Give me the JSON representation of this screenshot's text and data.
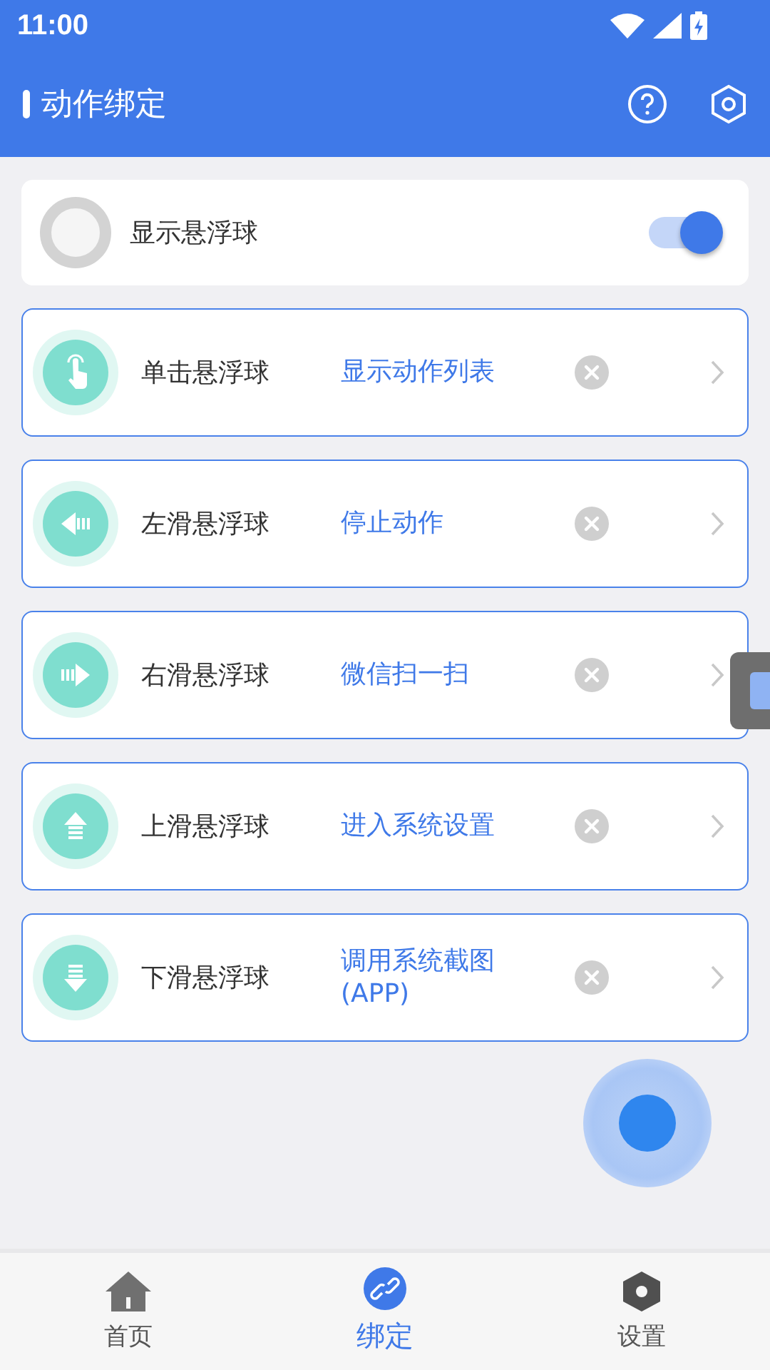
{
  "status_bar": {
    "time": "11:00"
  },
  "app_bar": {
    "title": "动作绑定"
  },
  "toggle_card": {
    "label": "显示悬浮球",
    "on": true
  },
  "bindings": [
    {
      "kind": "tap",
      "label": "单击悬浮球",
      "action": "显示动作列表"
    },
    {
      "kind": "left",
      "label": "左滑悬浮球",
      "action": "停止动作"
    },
    {
      "kind": "right",
      "label": "右滑悬浮球",
      "action": "微信扫一扫"
    },
    {
      "kind": "up",
      "label": "上滑悬浮球",
      "action": "进入系统设置"
    },
    {
      "kind": "down",
      "label": "下滑悬浮球",
      "action": "调用系统截图\n(APP)"
    }
  ],
  "bottom_nav": [
    {
      "kind": "home",
      "label": "首页",
      "selected": false
    },
    {
      "kind": "link",
      "label": "绑定",
      "selected": true
    },
    {
      "kind": "settings",
      "label": "设置",
      "selected": false
    }
  ]
}
